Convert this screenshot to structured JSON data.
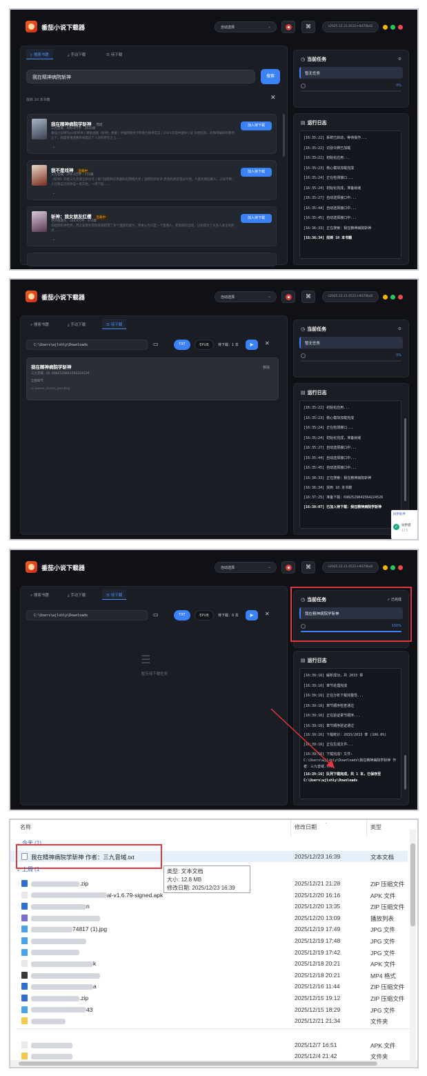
{
  "app": {
    "title": "番茄小说下载器",
    "source_select": "自动选择",
    "version": "v2025.12.21.0531+8470bd2",
    "colors": {
      "accent": "#3b82f6",
      "bg": "#0f1116",
      "panel": "#1a1d24",
      "dot_yellow": "#f5b800",
      "dot_green": "#2bc55b",
      "dot_red": "#f04b4b"
    }
  },
  "tabs": {
    "search": "搜索书籍",
    "manual": "手动下载",
    "queue": "待下载"
  },
  "screen1": {
    "search_value": "我在精神病院斩神",
    "search_button": "搜索",
    "found": "找到 10 本书籍",
    "results": [
      {
        "title": "我在精神病院学斩神",
        "badge": "完结",
        "meta": "三九音域 · 406.4万字 · 2033章",
        "desc": "番茄小说网Top2新榜书 | 爆款出圈《斩神》原著 | 中国网络文学影响力榜单前五 | 2023年度中国好小说 白昼在即，在晦暗破碎的都市之下，隔着重重迷雾俯视着这个人间的存在之上……",
        "add": "加入待下载"
      },
      {
        "title": "我不是戏神",
        "badge": "连载中",
        "meta": "三九音域 · 204.4万字 · 772章",
        "desc": "《斩神》作者三九音域全新力作 | 第门国际科幻原著科幻网络大奖 | 全网同步好评 赤色的洪流漫过大地，人类文明的路人。火焰不断，人们将自己的命运一再交给，一场下起……",
        "add": "加入待下载"
      },
      {
        "title": "斩神：我女朋友红缨",
        "badge": "连载中",
        "meta": "世外桃源九 · 164.9万字 · 976章",
        "desc": "穿越到斩神世界，苏言安意外得到系统获得了各个维度的能力，原本以为只是一个普通人，而系统的出现，让他成为了众多人关注的焦点……",
        "add": "加入待下载"
      }
    ],
    "current_task_title": "当前任务",
    "current_task": "暂无任务",
    "progress_pct": "0%",
    "progress_value": 0,
    "log_title": "运行日志",
    "logs": [
      "[16:35:22] 系统已启动，等待操作...",
      "[16:35:22] 识别令牌已加载",
      "[16:35:22] 初始化应用...",
      "[16:35:23] 核心模块加载完成",
      "[16:35:24] 正在检测接口...",
      "[16:35:24] 初始化完成，准备就绪",
      "[16:35:27] 自动选择接口中...",
      "[16:35:44] 自动选择接口中...",
      "[16:35:45] 自动选择接口中...",
      "[16:36:33] 正在搜索：我在精神病院斩神",
      "[16:36:34] 找到 10 本书籍"
    ]
  },
  "screen2": {
    "path": "C:\\Users\\wjlshly\\Downloads",
    "txt": "TXT",
    "epub": "EPUB",
    "pending": "待下载：1 本",
    "queue_item": {
      "title": "我在精神病院学斩神",
      "meta": "三九音域 · ID: 6982529841564224526",
      "range": "全部章节",
      "status": "queue_status_pending",
      "remove": "移除"
    },
    "current_task_title": "当前任务",
    "current_task": "暂无任务",
    "progress_pct": "0%",
    "progress_value": 0,
    "log_title": "运行日志",
    "logs": [
      "[16:35:22] 初始化应用...",
      "[16:35:23] 核心模块加载完成",
      "[16:35:24] 正在检测接口...",
      "[16:35:24] 初始化完成，准备就绪",
      "[16:35:27] 自动选择接口中...",
      "[16:35:44] 自动选择接口中...",
      "[16:35:45] 自动选择接口中...",
      "[16:36:33] 正在搜索：我在精神病院斩神",
      "[16:36:34] 找到 10 本书籍",
      "[16:37:25] 准备下载：6982529841564224526",
      "[16:38:07] 已加入待下载：我在精神病院学斩神"
    ],
    "toast_title": "同步助手",
    "toast_sub": "同步提",
    "toast_time": "17:5"
  },
  "screen3": {
    "path": "C:\\Users\\wjlshly\\Downloads",
    "txt": "TXT",
    "epub": "EPUB",
    "pending": "待下载：0 本",
    "empty": "暂无待下载任务",
    "current_task_title": "当前任务",
    "done_label": "已完成",
    "current_task": "我在精神病院学斩神",
    "progress_pct": "100%",
    "progress_value": 1.0,
    "log_title": "运行日志",
    "logs": [
      "[16:39:16] 解析成功，共 2033 章",
      "[16:39:16] 章节处理完成",
      "[16:39:16] 正在分析下载完整性...",
      "[16:39:16] 章节顺序检查通过",
      "[16:39:16] 正在验证章节顺序...",
      "[16:39:16] 章节顺序验证通过",
      "[16:39:16] 下载统计：2033/2033 章 (100.0%)",
      "[16:39:16] 正在生成文件...",
      "[16:39:16] 下载完成！文件：C:\\Users\\wjlshly\\Downloads\\我在精神病院学斩神 作者：三九音域.txt",
      "[16:39:16] 队列下载完成，共 1 本，已保存至 C:\\Users\\wjlshly\\Downloads"
    ]
  },
  "explorer": {
    "col_name": "名称",
    "col_date": "修改日期",
    "col_type": "类型",
    "group_today": "今天 (1)",
    "group_lastweek": "上周 (1",
    "highlight_file": {
      "name": "我在精神病院学斩神 作者：三九音域.txt",
      "date": "2025/12/23 16:39",
      "type": "文本文档"
    },
    "tooltip": {
      "type": "类型: 文本文档",
      "size": "大小: 12.8 MB",
      "date": "修改日期: 2025/12/23 16:39"
    },
    "rows": [
      {
        "name": ".zip",
        "date": "2025/12/21 21:28",
        "type": "ZIP 压缩文件"
      },
      {
        "name": "al-v1.6.79-signed.apk",
        "date": "2025/12/20 16:16",
        "type": "APK 文件"
      },
      {
        "name": "n",
        "date": "2025/12/20 13:35",
        "type": "ZIP 压缩文件"
      },
      {
        "name": "",
        "date": "2025/12/20 13:09",
        "type": "播放列表"
      },
      {
        "name": "74817 (1).jpg",
        "date": "2025/12/19 17:49",
        "type": "JPG 文件"
      },
      {
        "name": "",
        "date": "2025/12/19 17:48",
        "type": "JPG 文件"
      },
      {
        "name": "",
        "date": "2025/12/19 17:42",
        "type": "JPG 文件"
      },
      {
        "name": "k",
        "date": "2025/12/18 20:21",
        "type": "APK 文件"
      },
      {
        "name": "",
        "date": "2025/12/18 20:21",
        "type": "MP4 格式"
      },
      {
        "name": "a",
        "date": "2025/12/16 11:44",
        "type": "ZIP 压缩文件"
      },
      {
        "name": ".zip",
        "date": "2025/12/15 19:12",
        "type": "ZIP 压缩文件"
      },
      {
        "name": "43",
        "date": "2025/12/15 18:29",
        "type": "JPG 文件"
      },
      {
        "name": "",
        "date": "2025/12/21 21:34",
        "type": "文件夹"
      },
      {
        "name": "",
        "date": "2025/12/7 16:51",
        "type": "APK 文件"
      },
      {
        "name": "",
        "date": "2025/12/4 21:42",
        "type": "文件夹"
      }
    ]
  }
}
